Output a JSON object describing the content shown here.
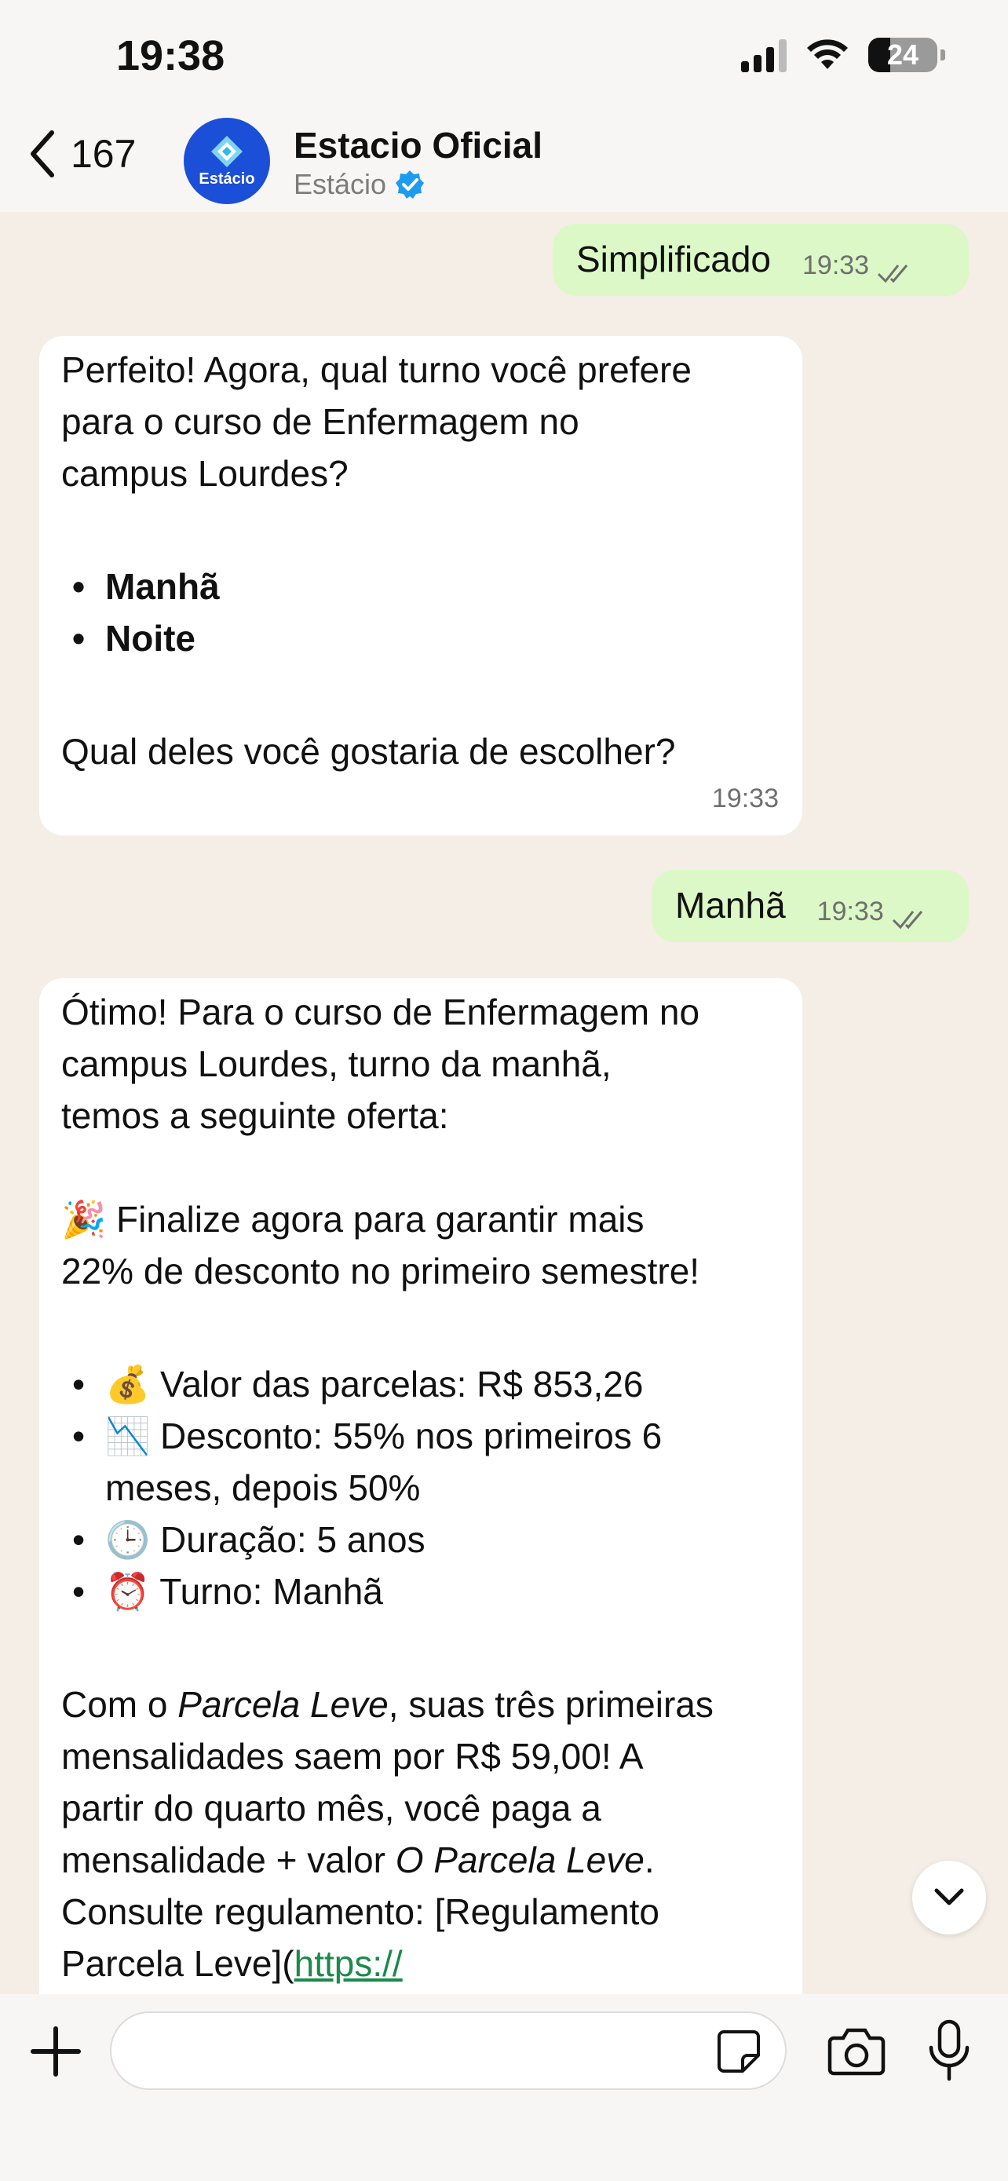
{
  "status": {
    "time": "19:38",
    "battery": "24"
  },
  "header": {
    "back_count": "167",
    "avatar_text": "Estácio",
    "contact_name": "Estacio Oficial",
    "contact_sub": "Estácio"
  },
  "messages": {
    "m1": {
      "text": "Simplificado",
      "time": "19:33"
    },
    "m2": {
      "line1": "Perfeito! Agora, qual turno você prefere",
      "line2": "para o curso de Enfermagem no",
      "line3": "campus Lourdes?",
      "opt1": "Manhã",
      "opt2": "Noite",
      "question": "Qual deles você gostaria de escolher?",
      "time": "19:33"
    },
    "m3": {
      "text": "Manhã",
      "time": "19:33"
    },
    "m4": {
      "intro1": "Ótimo! Para o curso de Enfermagem no",
      "intro2": "campus Lourdes, turno da manhã,",
      "intro3": "temos a seguinte oferta:",
      "promo1": "🎉 Finalize agora para garantir mais",
      "promo2": "22% de desconto no primeiro semestre!",
      "item1": "💰 Valor das parcelas: R$ 853,26",
      "item2a": "📉 Desconto: 55% nos primeiros 6",
      "item2b": "meses, depois 50%",
      "item3": "🕒 Duração: 5 anos",
      "item4": "⏰ Turno: Manhã",
      "p1_a": "Com o ",
      "p1_b": "Parcela Leve",
      "p1_c": ", suas três primeiras",
      "p2": "mensalidades saem por R$ 59,00! A",
      "p3": "partir do quarto mês, você paga a",
      "p4_a": "mensalidade + valor ",
      "p4_b": "O Parcela Leve",
      "p4_c": ".",
      "p5": "Consulte regulamento: [Regulamento",
      "p6_a": "Parcela Leve](",
      "p6_link": "https://"
    }
  },
  "composer": {
    "placeholder": ""
  },
  "icons": {
    "back": "chevron-left-icon",
    "verified": "verified-badge-icon",
    "scroll": "chevron-down-icon",
    "plus": "plus-icon",
    "sticker": "sticker-icon",
    "camera": "camera-icon",
    "mic": "microphone-icon"
  },
  "colors": {
    "outgoing_bubble": "#dcf8c6",
    "incoming_bubble": "#ffffff",
    "chat_background": "#f4eee6",
    "avatar": "#1c4fd8",
    "link": "#1b8a4a",
    "verified": "#1d9bf0",
    "read_ticks": "#53bdeb"
  }
}
